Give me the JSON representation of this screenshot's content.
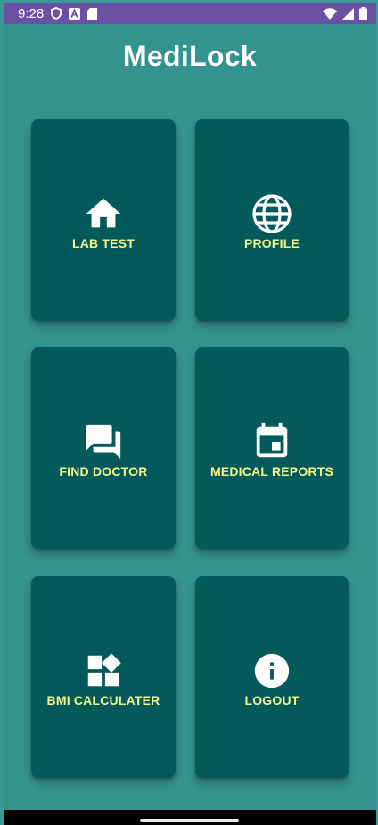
{
  "status_bar": {
    "time": "9:28",
    "icons_left": [
      "shield-icon",
      "a-app-icon",
      "sd-card-icon"
    ],
    "icons_right": [
      "wifi-icon",
      "signal-icon",
      "battery-icon"
    ],
    "background": "#6c50a4"
  },
  "app": {
    "title": "MediLock",
    "background": "#35938f",
    "tile_color": "#04595a",
    "label_color": "#f6f68a"
  },
  "tiles": [
    {
      "label": "LAB TEST",
      "icon": "home-icon"
    },
    {
      "label": "PROFILE",
      "icon": "globe-icon"
    },
    {
      "label": "FIND DOCTOR",
      "icon": "chat-icon"
    },
    {
      "label": "MEDICAL REPORTS",
      "icon": "calendar-icon"
    },
    {
      "label": "BMI CALCULATER",
      "icon": "widgets-icon"
    },
    {
      "label": "LOGOUT",
      "icon": "info-icon"
    }
  ]
}
